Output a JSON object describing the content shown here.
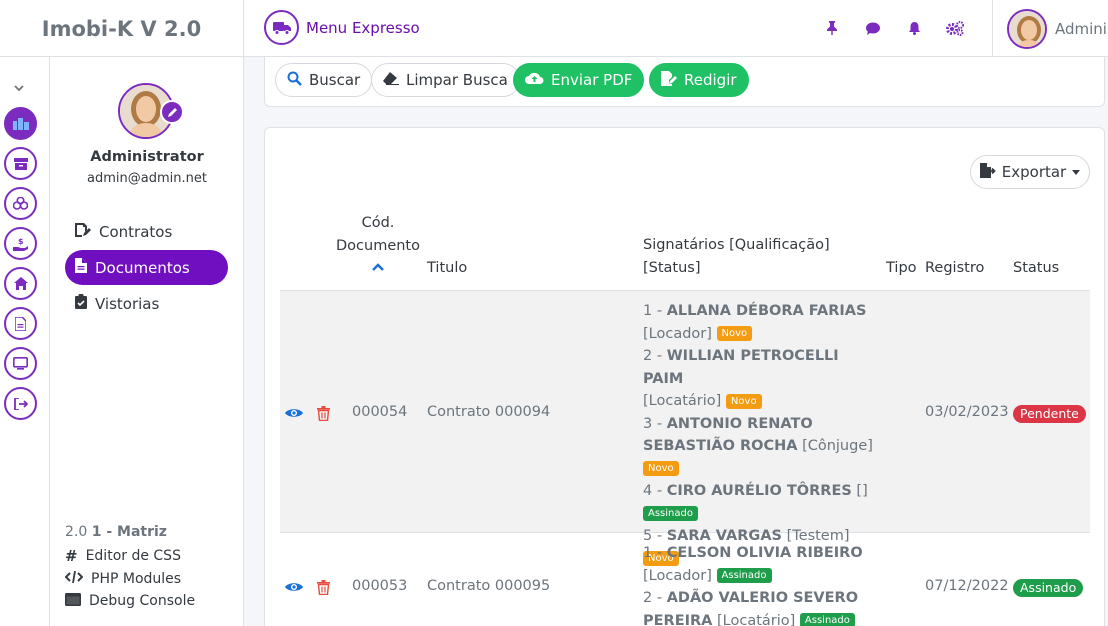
{
  "app": {
    "title": "Imobi-K V 2.0"
  },
  "topbar": {
    "menu_expresso": "Menu Expresso",
    "icons": [
      "pin-icon",
      "chat-icon",
      "bell-icon",
      "settings-icon"
    ],
    "user_label": "Administrator"
  },
  "mini_sidebar": {
    "icons": [
      "chevron-down-icon",
      "buildings-icon",
      "archive-icon",
      "coins-icon",
      "hand-money-icon",
      "home-icon",
      "document-icon",
      "monitor-icon",
      "sign-out-icon"
    ]
  },
  "sidebar": {
    "name": "Administrator",
    "email": "admin@admin.net",
    "items": [
      {
        "label": "Contratos",
        "icon": "contract-edit-icon",
        "active": false
      },
      {
        "label": "Documentos",
        "icon": "file-icon",
        "active": true
      },
      {
        "label": "Vistorias",
        "icon": "clipboard-check-icon",
        "active": false
      }
    ],
    "footer": {
      "version": "2.0",
      "branch": "1 - Matriz",
      "links": [
        {
          "label": "Editor de CSS",
          "icon": "hashtag-icon"
        },
        {
          "label": "PHP Modules",
          "icon": "code-icon"
        },
        {
          "label": "Debug Console",
          "icon": "console-icon"
        }
      ]
    }
  },
  "toolbar": {
    "buscar": "Buscar",
    "limpar": "Limpar Busca",
    "enviar_pdf": "Enviar PDF",
    "redigir": "Redigir"
  },
  "table": {
    "exportar": "Exportar",
    "headers": {
      "cod_line1": "Cód.",
      "cod_line2": "Documento",
      "titulo": "Titulo",
      "sig_line1": "Signatários [Qualificação]",
      "sig_line2": "[Status]",
      "tipo": "Tipo",
      "registro": "Registro",
      "status": "Status"
    },
    "rows": [
      {
        "codigo": "000054",
        "titulo": "Contrato 000094",
        "registro": "03/02/2023",
        "status": "Pendente",
        "signatarios": [
          {
            "n": "1 - ",
            "name": "ALLANA DÉBORA FARIAS",
            "qual": "[Locador]",
            "badge": "Novo"
          },
          {
            "n": "2 - ",
            "name": "WILLIAN PETROCELLI PAIM",
            "qual": "[Locatário]",
            "badge": "Novo"
          },
          {
            "n": "3 - ",
            "name_a": "ANTONIO RENATO",
            "name_b": "SEBASTIÃO ROCHA",
            "qual": "[Cônjuge]",
            "badge": "Novo"
          },
          {
            "n": "4 - ",
            "name": "CIRO AURÉLIO TÔRRES",
            "qual": "[]",
            "badge": "Assinado"
          },
          {
            "n": "5 - ",
            "name": "SARA VARGAS",
            "qual": "[Testem]",
            "badge": "Novo"
          }
        ]
      },
      {
        "codigo": "000053",
        "titulo": "Contrato 000095",
        "registro": "07/12/2022",
        "status": "Assinado",
        "signatarios": [
          {
            "n": "1 - ",
            "name": "CELSON OLIVIA RIBEIRO",
            "qual": "[Locador]",
            "badge": "Assinado"
          },
          {
            "n": "2 - ",
            "name_a": "ADÃO VALERIO SEVERO",
            "name_b": "PEREIRA",
            "qual": "[Locatário]",
            "badge": "Assinado"
          }
        ]
      }
    ]
  }
}
